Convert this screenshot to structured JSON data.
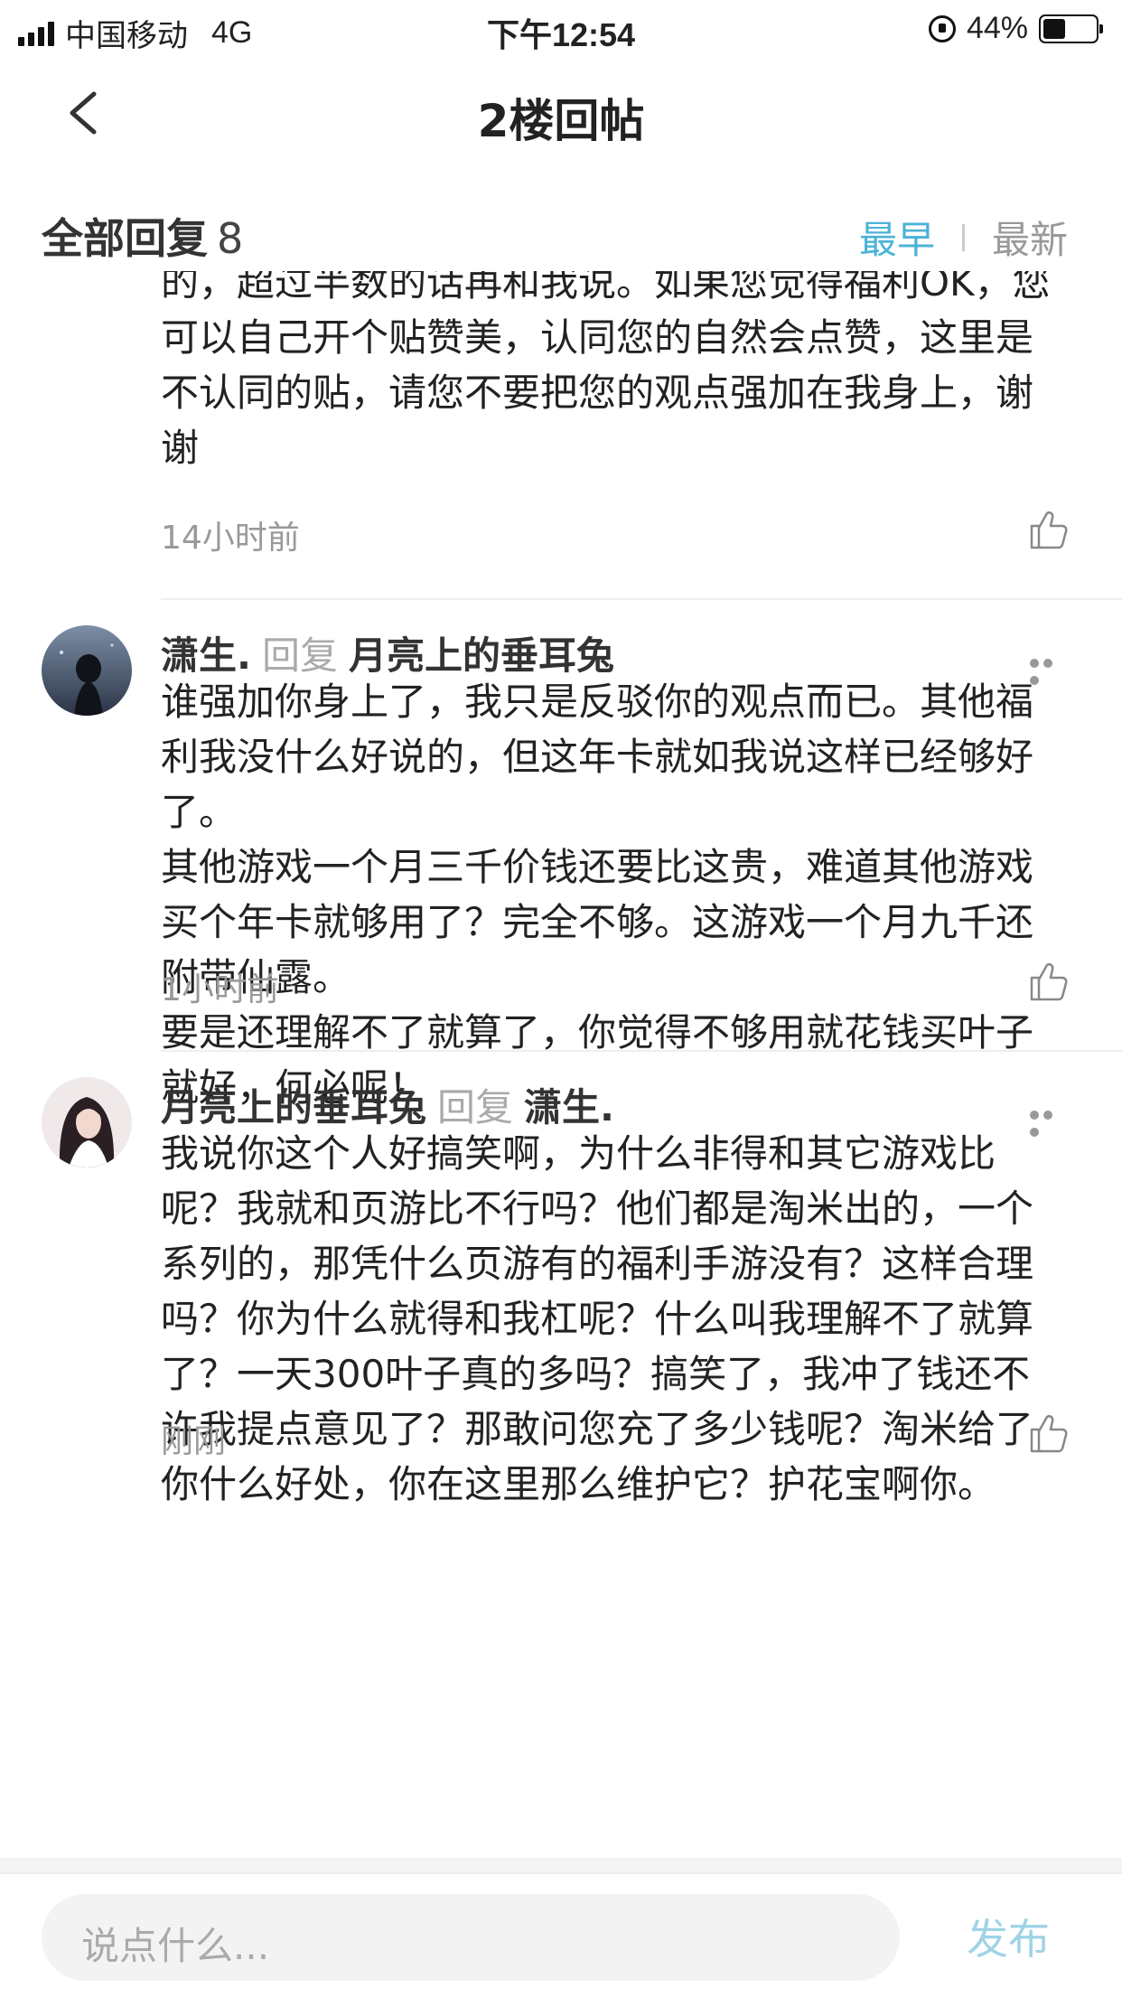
{
  "status_bar": {
    "carrier": "中国移动",
    "network": "4G",
    "time": "下午12:54",
    "battery": "44%"
  },
  "nav": {
    "title": "2楼回帖"
  },
  "section": {
    "title": "全部回复",
    "count": "8",
    "sort_early": "最早",
    "sort_latest": "最新"
  },
  "comments": [
    {
      "user": "",
      "reply_word": "",
      "reply_to": "",
      "text": "的，超过半数的话再和我说。如果您觉得福利OK，您可以自己开个贴赞美，认同您的自然会点赞，这里是不认同的贴，请您不要把您的观点强加在我身上，谢谢",
      "time": "14小时前"
    },
    {
      "user": "潇生.",
      "reply_word": "回复",
      "reply_to": "月亮上的垂耳兔",
      "text": "谁强加你身上了，我只是反驳你的观点而已。其他福利我没什么好说的，但这年卡就如我说这样已经够好了。\n其他游戏一个月三千价钱还要比这贵，难道其他游戏买个年卡就够用了？完全不够。这游戏一个月九千还附带仙露。\n要是还理解不了就算了，你觉得不够用就花钱买叶子就好，何必呢！",
      "time": "1小时前"
    },
    {
      "user": "月亮上的垂耳兔",
      "reply_word": "回复",
      "reply_to": "潇生.",
      "text": "我说你这个人好搞笑啊，为什么非得和其它游戏比呢？我就和页游比不行吗？他们都是淘米出的，一个系列的，那凭什么页游有的福利手游没有？这样合理吗？你为什么就得和我杠呢？什么叫我理解不了就算了？一天300叶子真的多吗？搞笑了，我冲了钱还不许我提点意见了？那敢问您充了多少钱呢？淘米给了你什么好处，你在这里那么维护它？护花宝啊你。",
      "time": "刚刚"
    }
  ],
  "composer": {
    "placeholder": "说点什么...",
    "send_label": "发布"
  },
  "colors": {
    "accent": "#4bb3d6",
    "send_disabled": "#9fd3e6",
    "muted": "#999999"
  },
  "icons": [
    "signal-icon",
    "lock-rotation-icon",
    "battery-icon",
    "back-icon",
    "more-icon",
    "thumbs-up-icon"
  ]
}
